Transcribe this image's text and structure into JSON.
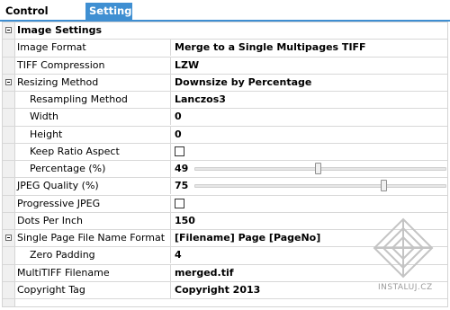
{
  "tabs": [
    {
      "label": "Control Center",
      "active": false
    },
    {
      "label": "Settings",
      "active": true
    }
  ],
  "category": {
    "label": "Image Settings",
    "expanded": true
  },
  "properties": {
    "image_format": {
      "label": "Image Format",
      "value": "Merge to a Single Multipages TIFF"
    },
    "tiff_compression": {
      "label": "TIFF Compression",
      "value": "LZW"
    },
    "resizing_method": {
      "label": "Resizing Method",
      "value": "Downsize by Percentage"
    },
    "resampling_method": {
      "label": "Resampling Method",
      "value": "Lanczos3"
    },
    "width": {
      "label": "Width",
      "value": "0"
    },
    "height": {
      "label": "Height",
      "value": "0"
    },
    "keep_ratio_aspect": {
      "label": "Keep Ratio Aspect",
      "checked": false
    },
    "percentage": {
      "label": "Percentage (%)",
      "value": "49",
      "slider_fraction": 0.49
    },
    "jpeg_quality": {
      "label": "JPEG Quality (%)",
      "value": "75",
      "slider_fraction": 0.75
    },
    "progressive_jpeg": {
      "label": "Progressive JPEG",
      "checked": false
    },
    "dots_per_inch": {
      "label": "Dots Per Inch",
      "value": "150"
    },
    "single_page_file_name_format": {
      "label": "Single Page File Name Format",
      "value": "[Filename] Page [PageNo]"
    },
    "zero_padding": {
      "label": "Zero Padding",
      "value": "4"
    },
    "multitiff_filename": {
      "label": "MultiTIFF Filename",
      "value": "merged.tif"
    },
    "copyright_tag": {
      "label": "Copyright Tag",
      "value": "Copyright 2013"
    }
  },
  "watermark": {
    "text": "INSTALUJ.CZ"
  },
  "colors": {
    "accent": "#3f8fd2"
  }
}
